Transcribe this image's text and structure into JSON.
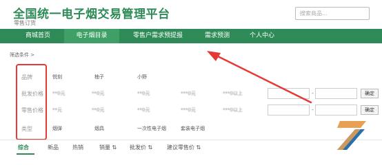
{
  "header": {
    "title": "全国统一电子烟交易管理平台",
    "subtitle": "零售订货",
    "search_placeholder": "搜索商品..."
  },
  "nav": {
    "items": [
      {
        "label": "商城首页"
      },
      {
        "label": "电子烟目录"
      },
      {
        "label": "零售户需求预提报"
      },
      {
        "label": "需求预测"
      },
      {
        "label": "个人中心"
      }
    ]
  },
  "filter": {
    "breadcrumb": "筛选条件 >",
    "rows": [
      {
        "label": "品牌",
        "options": [
          "悦刻",
          "柚子",
          "小野"
        ]
      },
      {
        "label": "批发价格",
        "options": [
          "**0元",
          "**0元",
          "**0元",
          "***0元",
          "***0以上"
        ],
        "range_sep": "-",
        "confirm": "确定"
      },
      {
        "label": "零售价格",
        "options": [
          "**元",
          "**0元",
          "**0元",
          "***0元",
          "***0以上"
        ],
        "range_sep": "-",
        "confirm": "确定"
      },
      {
        "label": "类型",
        "options": [
          "烟弹",
          "烟具",
          "一次性电子烟",
          "套装电子烟"
        ]
      }
    ]
  },
  "sort": {
    "items": [
      "综合",
      "新品",
      "热销",
      "销量 ⇅",
      "批发价 ⇅",
      "建议零售价 ⇅"
    ]
  },
  "colors": {
    "brand_green": "#2e8b57",
    "highlight_red": "#e53935"
  }
}
